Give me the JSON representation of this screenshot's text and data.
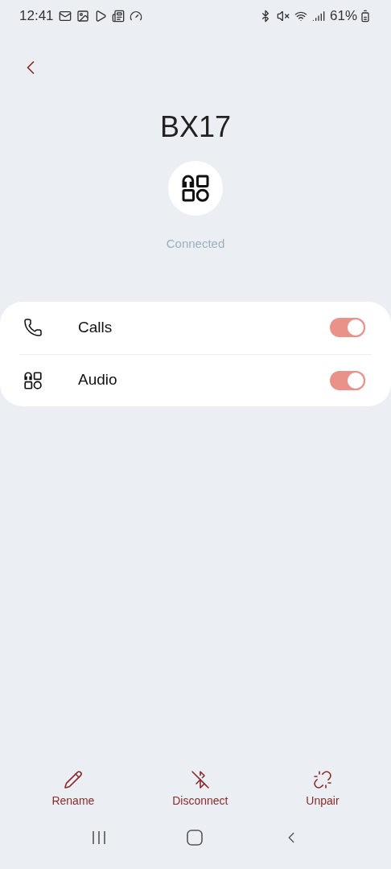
{
  "status_bar": {
    "time": "12:41",
    "battery": "61%"
  },
  "title": "BX17",
  "status": "Connected",
  "settings": [
    {
      "kind": "calls",
      "label": "Calls",
      "on": true
    },
    {
      "kind": "audio",
      "label": "Audio",
      "on": true
    }
  ],
  "actions": [
    {
      "kind": "rename",
      "label": "Rename"
    },
    {
      "kind": "disconnect",
      "label": "Disconnect"
    },
    {
      "kind": "unpair",
      "label": "Unpair"
    }
  ]
}
